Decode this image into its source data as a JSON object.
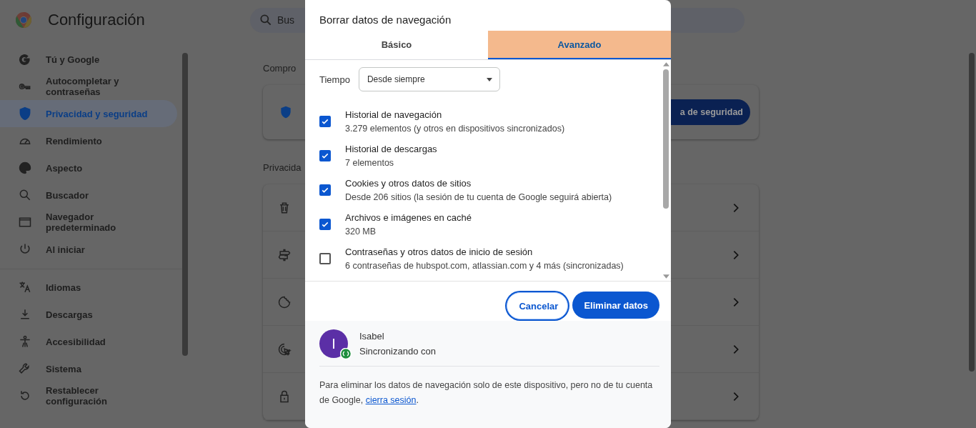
{
  "header": {
    "title": "Configuración"
  },
  "search": {
    "placeholder": "Bus"
  },
  "sidebar": {
    "sections": [
      [
        {
          "label": "Tú y Google",
          "selected": false
        },
        {
          "label": "Autocompletar y contraseñas",
          "selected": false
        },
        {
          "label": "Privacidad y seguridad",
          "selected": true
        },
        {
          "label": "Rendimiento",
          "selected": false
        },
        {
          "label": "Aspecto",
          "selected": false
        },
        {
          "label": "Buscador",
          "selected": false
        },
        {
          "label": "Navegador predeterminado",
          "selected": false
        },
        {
          "label": "Al iniciar",
          "selected": false
        }
      ],
      [
        {
          "label": "Idiomas",
          "selected": false
        },
        {
          "label": "Descargas",
          "selected": false
        },
        {
          "label": "Accesibilidad",
          "selected": false
        },
        {
          "label": "Sistema",
          "selected": false
        },
        {
          "label": "Restablecer configuración",
          "selected": false
        }
      ]
    ]
  },
  "main": {
    "safety_heading": "Compro",
    "safety_button": "a de seguridad",
    "privacy_heading": "Privacida"
  },
  "dialog": {
    "title": "Borrar datos de navegación",
    "tabs": [
      {
        "label": "Básico",
        "selected": false
      },
      {
        "label": "Avanzado",
        "selected": true
      }
    ],
    "time": {
      "label": "Tiempo",
      "value": "Desde siempre"
    },
    "options": [
      {
        "title": "Historial de navegación",
        "detail": "3.279 elementos (y otros en dispositivos sincronizados)",
        "checked": true
      },
      {
        "title": "Historial de descargas",
        "detail": "7 elementos",
        "checked": true
      },
      {
        "title": "Cookies y otros datos de sitios",
        "detail": "Desde 206 sitios (la sesión de tu cuenta de Google seguirá abierta)",
        "checked": true
      },
      {
        "title": "Archivos e imágenes en caché",
        "detail": "320 MB",
        "checked": true
      },
      {
        "title": "Contraseñas y otros datos de inicio de sesión",
        "detail": "6 contraseñas de hubspot.com, atlassian.com y 4 más (sincronizadas)",
        "checked": false
      }
    ],
    "buttons": [
      {
        "label": "Cancelar",
        "kind": "secondary"
      },
      {
        "label": "Eliminar datos",
        "kind": "primary"
      }
    ],
    "account": {
      "initial": "I",
      "name": "Isabel",
      "status": "Sincronizando con"
    },
    "note": {
      "text": "Para eliminar los datos de navegación solo de este dispositivo, pero no de tu cuenta de Google, ",
      "link": "cierra sesión",
      "after": "."
    }
  }
}
